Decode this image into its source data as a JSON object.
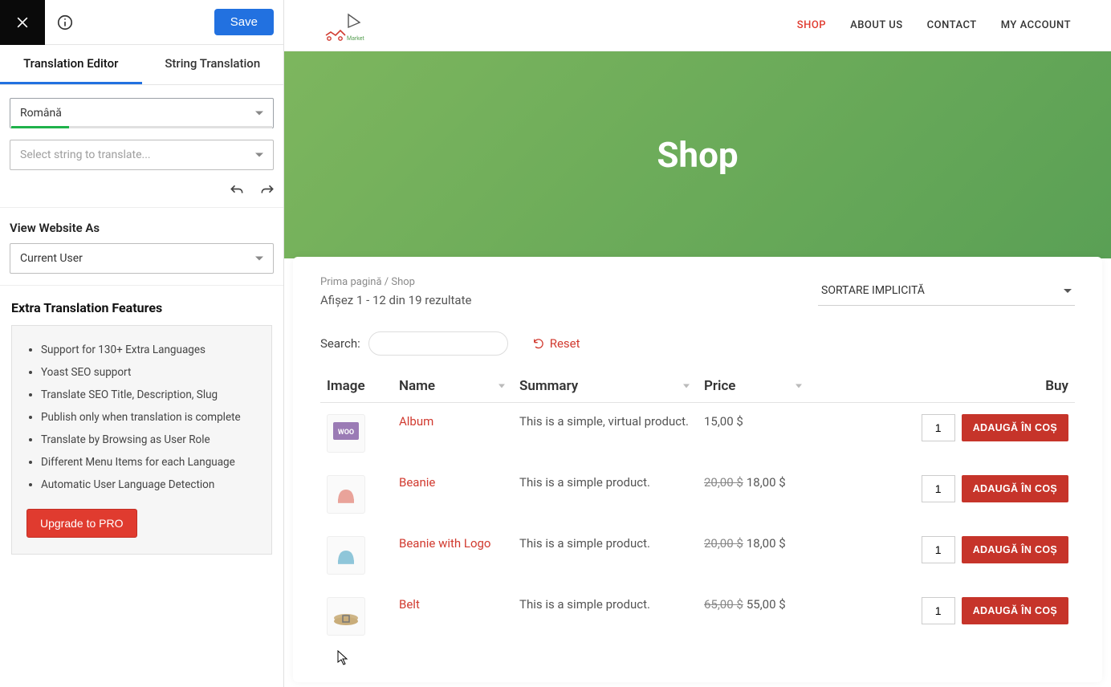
{
  "sidebar": {
    "save_label": "Save",
    "tabs": {
      "editor": "Translation Editor",
      "string": "String Translation"
    },
    "language_value": "Română",
    "string_placeholder": "Select string to translate...",
    "view_as_label": "View Website As",
    "view_as_value": "Current User",
    "features_heading": "Extra Translation Features",
    "features": [
      "Support for 130+ Extra Languages",
      "Yoast SEO support",
      "Translate SEO Title, Description, Slug",
      "Publish only when translation is complete",
      "Translate by Browsing as User Role",
      "Different Menu Items for each Language",
      "Automatic User Language Detection"
    ],
    "upgrade_label": "Upgrade to PRO"
  },
  "site": {
    "nav": {
      "shop": "SHOP",
      "about": "ABOUT US",
      "contact": "CONTACT",
      "account": "MY ACCOUNT"
    },
    "hero_title": "Shop",
    "breadcrumb": "Prima pagină / Shop",
    "results": "Afișez 1 - 12 din 19 rezultate",
    "sort_value": "SORTARE IMPLICITĂ",
    "search_label": "Search:",
    "reset_label": "Reset",
    "columns": {
      "image": "Image",
      "name": "Name",
      "summary": "Summary",
      "price": "Price",
      "buy": "Buy"
    },
    "add_label": "ADAUGĂ ÎN COȘ",
    "products": [
      {
        "name": "Album",
        "summary": "This is a simple, virtual product.",
        "price": "15,00 $",
        "qty": "1",
        "thumb_color": "#9b7bb5",
        "thumb_text": "WOO"
      },
      {
        "name": "Beanie",
        "summary": "This is a simple product.",
        "old": "20,00 $",
        "price": "18,00 $",
        "qty": "1",
        "thumb_color": "#e9a39a",
        "thumb_shape": "hat"
      },
      {
        "name": "Beanie with Logo",
        "summary": "This is a simple product.",
        "old": "20,00 $",
        "price": "18,00 $",
        "qty": "1",
        "thumb_color": "#8fc6d9",
        "thumb_shape": "hat"
      },
      {
        "name": "Belt",
        "summary": "This is a simple product.",
        "old": "65,00 $",
        "price": "55,00 $",
        "qty": "1",
        "thumb_color": "#c9ad7a",
        "thumb_shape": "belt"
      }
    ]
  }
}
